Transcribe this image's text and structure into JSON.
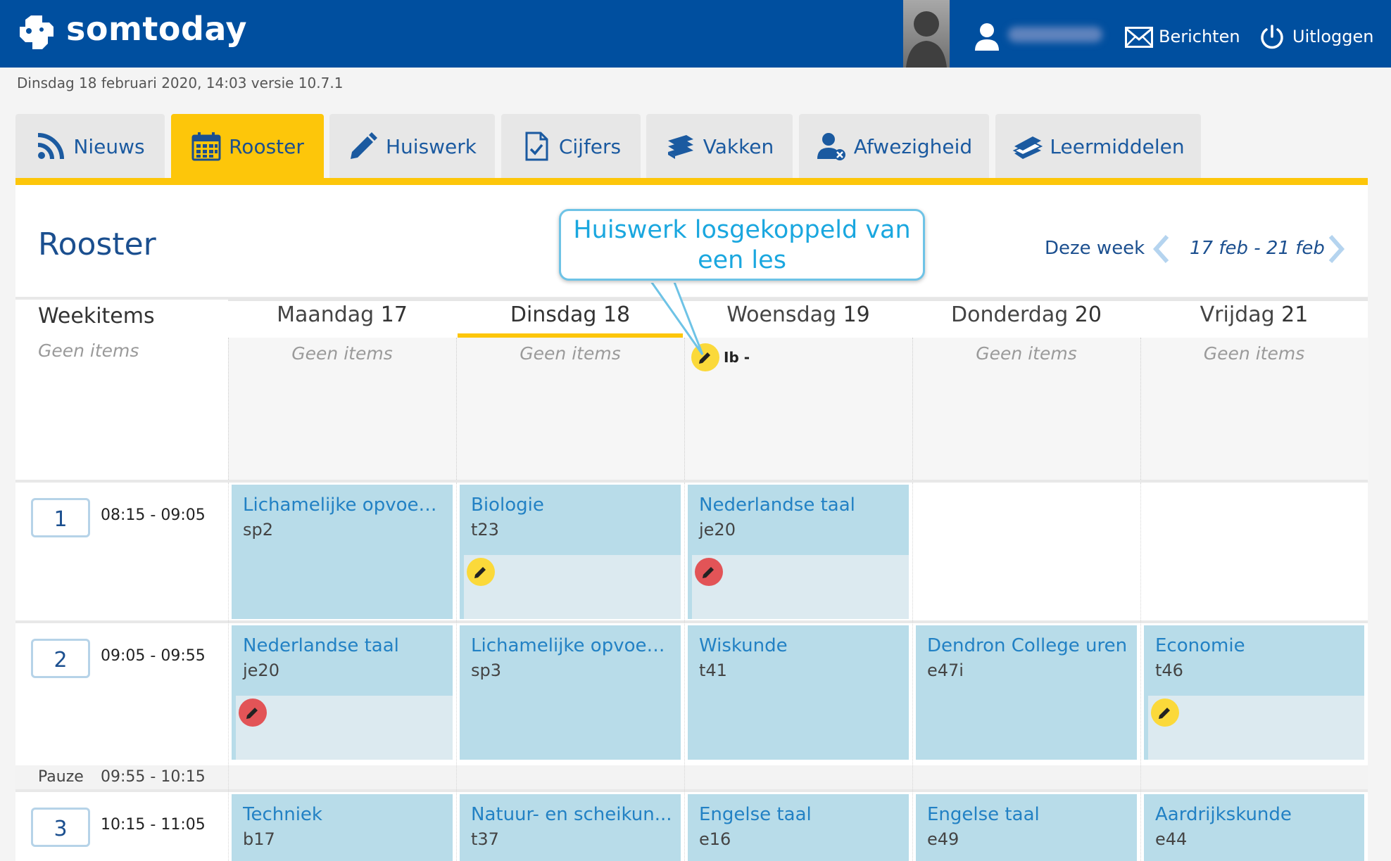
{
  "header": {
    "app_name": "somtoday",
    "user_name": "",
    "messages_label": "Berichten",
    "logout_label": "Uitloggen",
    "bg_color": "#004f9f"
  },
  "datestamp": "Dinsdag 18 februari 2020, 14:03 versie 10.7.1",
  "tabs": [
    {
      "label": "Nieuws",
      "icon": "rss-icon",
      "active": false
    },
    {
      "label": "Rooster",
      "icon": "calendar-icon",
      "active": true
    },
    {
      "label": "Huiswerk",
      "icon": "pencil-icon",
      "active": false
    },
    {
      "label": "Cijfers",
      "icon": "document-check-icon",
      "active": false
    },
    {
      "label": "Vakken",
      "icon": "books-icon",
      "active": false
    },
    {
      "label": "Afwezigheid",
      "icon": "user-absent-icon",
      "active": false
    },
    {
      "label": "Leermiddelen",
      "icon": "book-icon",
      "active": false
    }
  ],
  "rooster": {
    "title": "Rooster",
    "this_week_label": "Deze week",
    "week_range": "17 feb - 21 feb",
    "callout": "Huiswerk losgekoppeld van een les",
    "weekitems_label": "Weekitems",
    "geen_items": "Geen items",
    "days": [
      {
        "name": "Maandag",
        "num": "17"
      },
      {
        "name": "Dinsdag",
        "num": "18"
      },
      {
        "name": "Woensdag",
        "num": "19"
      },
      {
        "name": "Donderdag",
        "num": "20"
      },
      {
        "name": "Vrijdag",
        "num": "21"
      }
    ],
    "week_homework_label": "Ib -",
    "pauze_label": "Pauze",
    "pauze_time": "09:55 - 10:15",
    "periods": [
      {
        "num": "1",
        "time": "08:15 - 09:05",
        "lessons": [
          {
            "title": "Lichamelijke opvoed...",
            "room": "sp2",
            "hw": null
          },
          {
            "title": "Biologie",
            "room": "t23",
            "hw": "yellow"
          },
          {
            "title": "Nederlandse taal",
            "room": "je20",
            "hw": "red"
          },
          null,
          null
        ]
      },
      {
        "num": "2",
        "time": "09:05 - 09:55",
        "lessons": [
          {
            "title": "Nederlandse taal",
            "room": "je20",
            "hw": "red"
          },
          {
            "title": "Lichamelijke opvoed...",
            "room": "sp3",
            "hw": null
          },
          {
            "title": "Wiskunde",
            "room": "t41",
            "hw": null
          },
          {
            "title": "Dendron College uren",
            "room": "e47i",
            "hw": null
          },
          {
            "title": "Economie",
            "room": "t46",
            "hw": "yellow"
          }
        ]
      },
      {
        "num": "3",
        "time": "10:15 - 11:05",
        "lessons": [
          {
            "title": "Techniek",
            "room": "b17",
            "hw": null
          },
          {
            "title": "Natuur- en scheikun...",
            "room": "t37",
            "hw": null
          },
          {
            "title": "Engelse taal",
            "room": "e16",
            "hw": null
          },
          {
            "title": "Engelse taal",
            "room": "e49",
            "hw": null
          },
          {
            "title": "Aardrijkskunde",
            "room": "e44",
            "hw": null
          }
        ]
      }
    ]
  }
}
